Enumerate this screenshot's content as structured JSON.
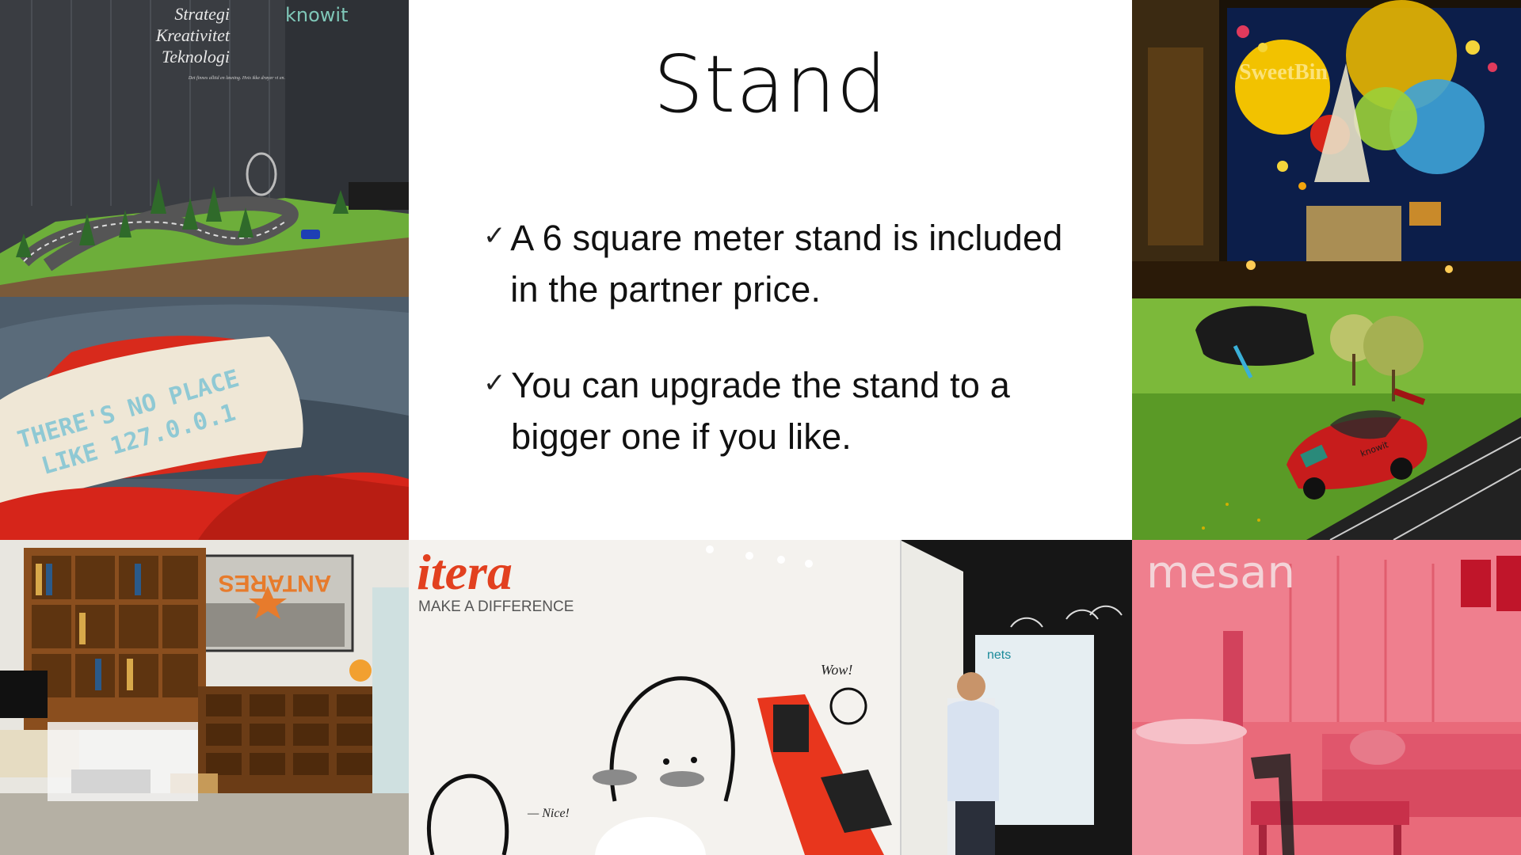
{
  "slide": {
    "title": "Stand",
    "bullets": [
      {
        "icon": "check-icon",
        "text": "A 6 square meter stand is included in the partner price."
      },
      {
        "icon": "check-icon",
        "text": "You can upgrade the stand to a bigger one if you like."
      }
    ],
    "check_glyph": "✓"
  },
  "photos": {
    "track": {
      "signage": [
        "Strategi",
        "Kreativitet",
        "Teknologi"
      ],
      "brand": "knowit",
      "caption": "Det finnes alltid en løsning. Hvis ikke drøyer vi en."
    },
    "pillow": {
      "embroidery": [
        "THERE'S NO PLACE",
        "LIKE 127.0.0.1"
      ]
    },
    "sweetbin": {
      "logo": "SweetBin"
    },
    "car": {
      "decal": "knowit"
    },
    "antares": {
      "sign": "ANTARES"
    },
    "itera": {
      "logo": "itera",
      "tagline": "MAKE A DIFFERENCE",
      "doodle_1": "Wow!",
      "doodle_2": "— Nice!",
      "nets": "nets"
    },
    "mesan": {
      "logo": "mesan"
    }
  }
}
